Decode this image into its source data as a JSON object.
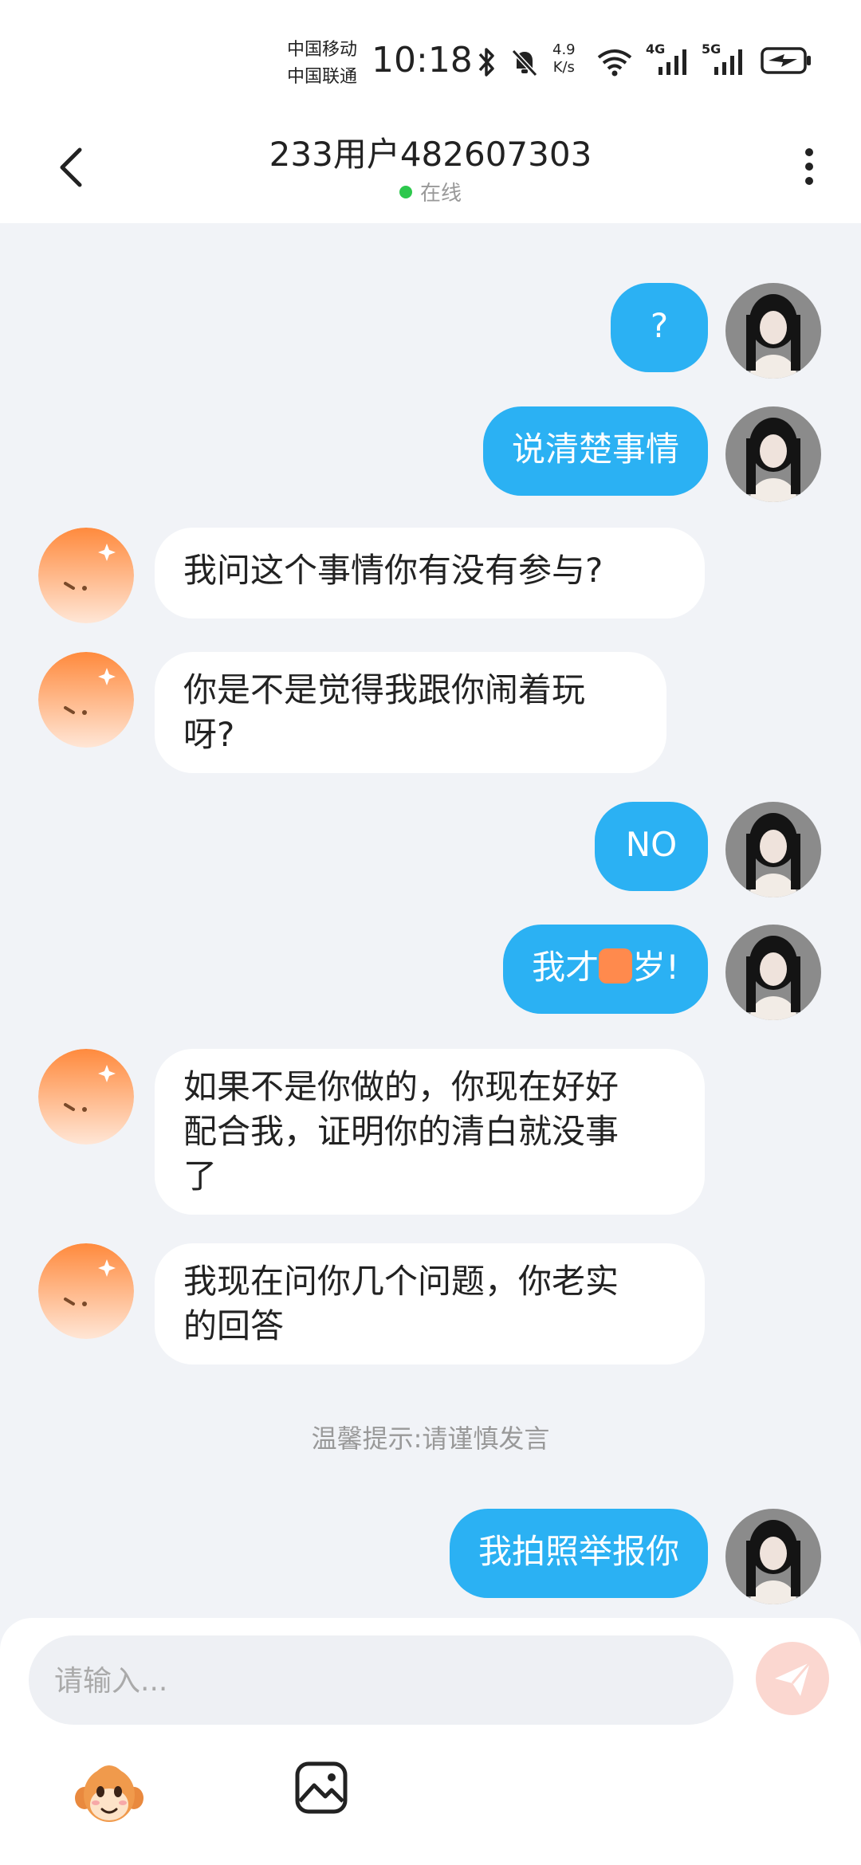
{
  "status_bar": {
    "carrier_1": "中国移动",
    "carrier_2": "中国联通",
    "time": "10:18",
    "speed_value": "4.9",
    "speed_unit": "K/s",
    "signal_1": "4G",
    "signal_2": "5G",
    "icons": [
      "bluetooth-icon",
      "mute-icon",
      "wifi-icon",
      "signal-4g-icon",
      "signal-5g-icon",
      "battery-charging-icon"
    ]
  },
  "header": {
    "title": "233用户482607303",
    "status": "在线"
  },
  "messages": [
    {
      "side": "out",
      "text": "?"
    },
    {
      "side": "out",
      "text": "说清楚事情"
    },
    {
      "side": "in",
      "text": "我问这个事情你有没有参与?"
    },
    {
      "side": "in",
      "line1": "你是不是觉得我跟你闹着玩",
      "line2": "呀?"
    },
    {
      "side": "out",
      "text": "NO"
    },
    {
      "side": "out",
      "prefix": "我才",
      "suffix": "岁!"
    },
    {
      "side": "in",
      "line1": "如果不是你做的，你现在好好",
      "line2": "配合我，证明你的清白就没事",
      "line3": "了"
    },
    {
      "side": "in",
      "line1": "我现在问你几个问题，你老实",
      "line2": "的回答"
    },
    {
      "side": "out",
      "text": "我拍照举报你"
    }
  ],
  "tip": "温馨提示:请谨慎发言",
  "composer": {
    "placeholder": "请输入..."
  },
  "colors": {
    "outgoing_bubble": "#2bb1f3",
    "incoming_bubble": "#ffffff",
    "background": "#f1f3f7",
    "online": "#2dc84d",
    "send_button": "#fbd7d0",
    "bot_avatar": "#ff9a4d"
  }
}
